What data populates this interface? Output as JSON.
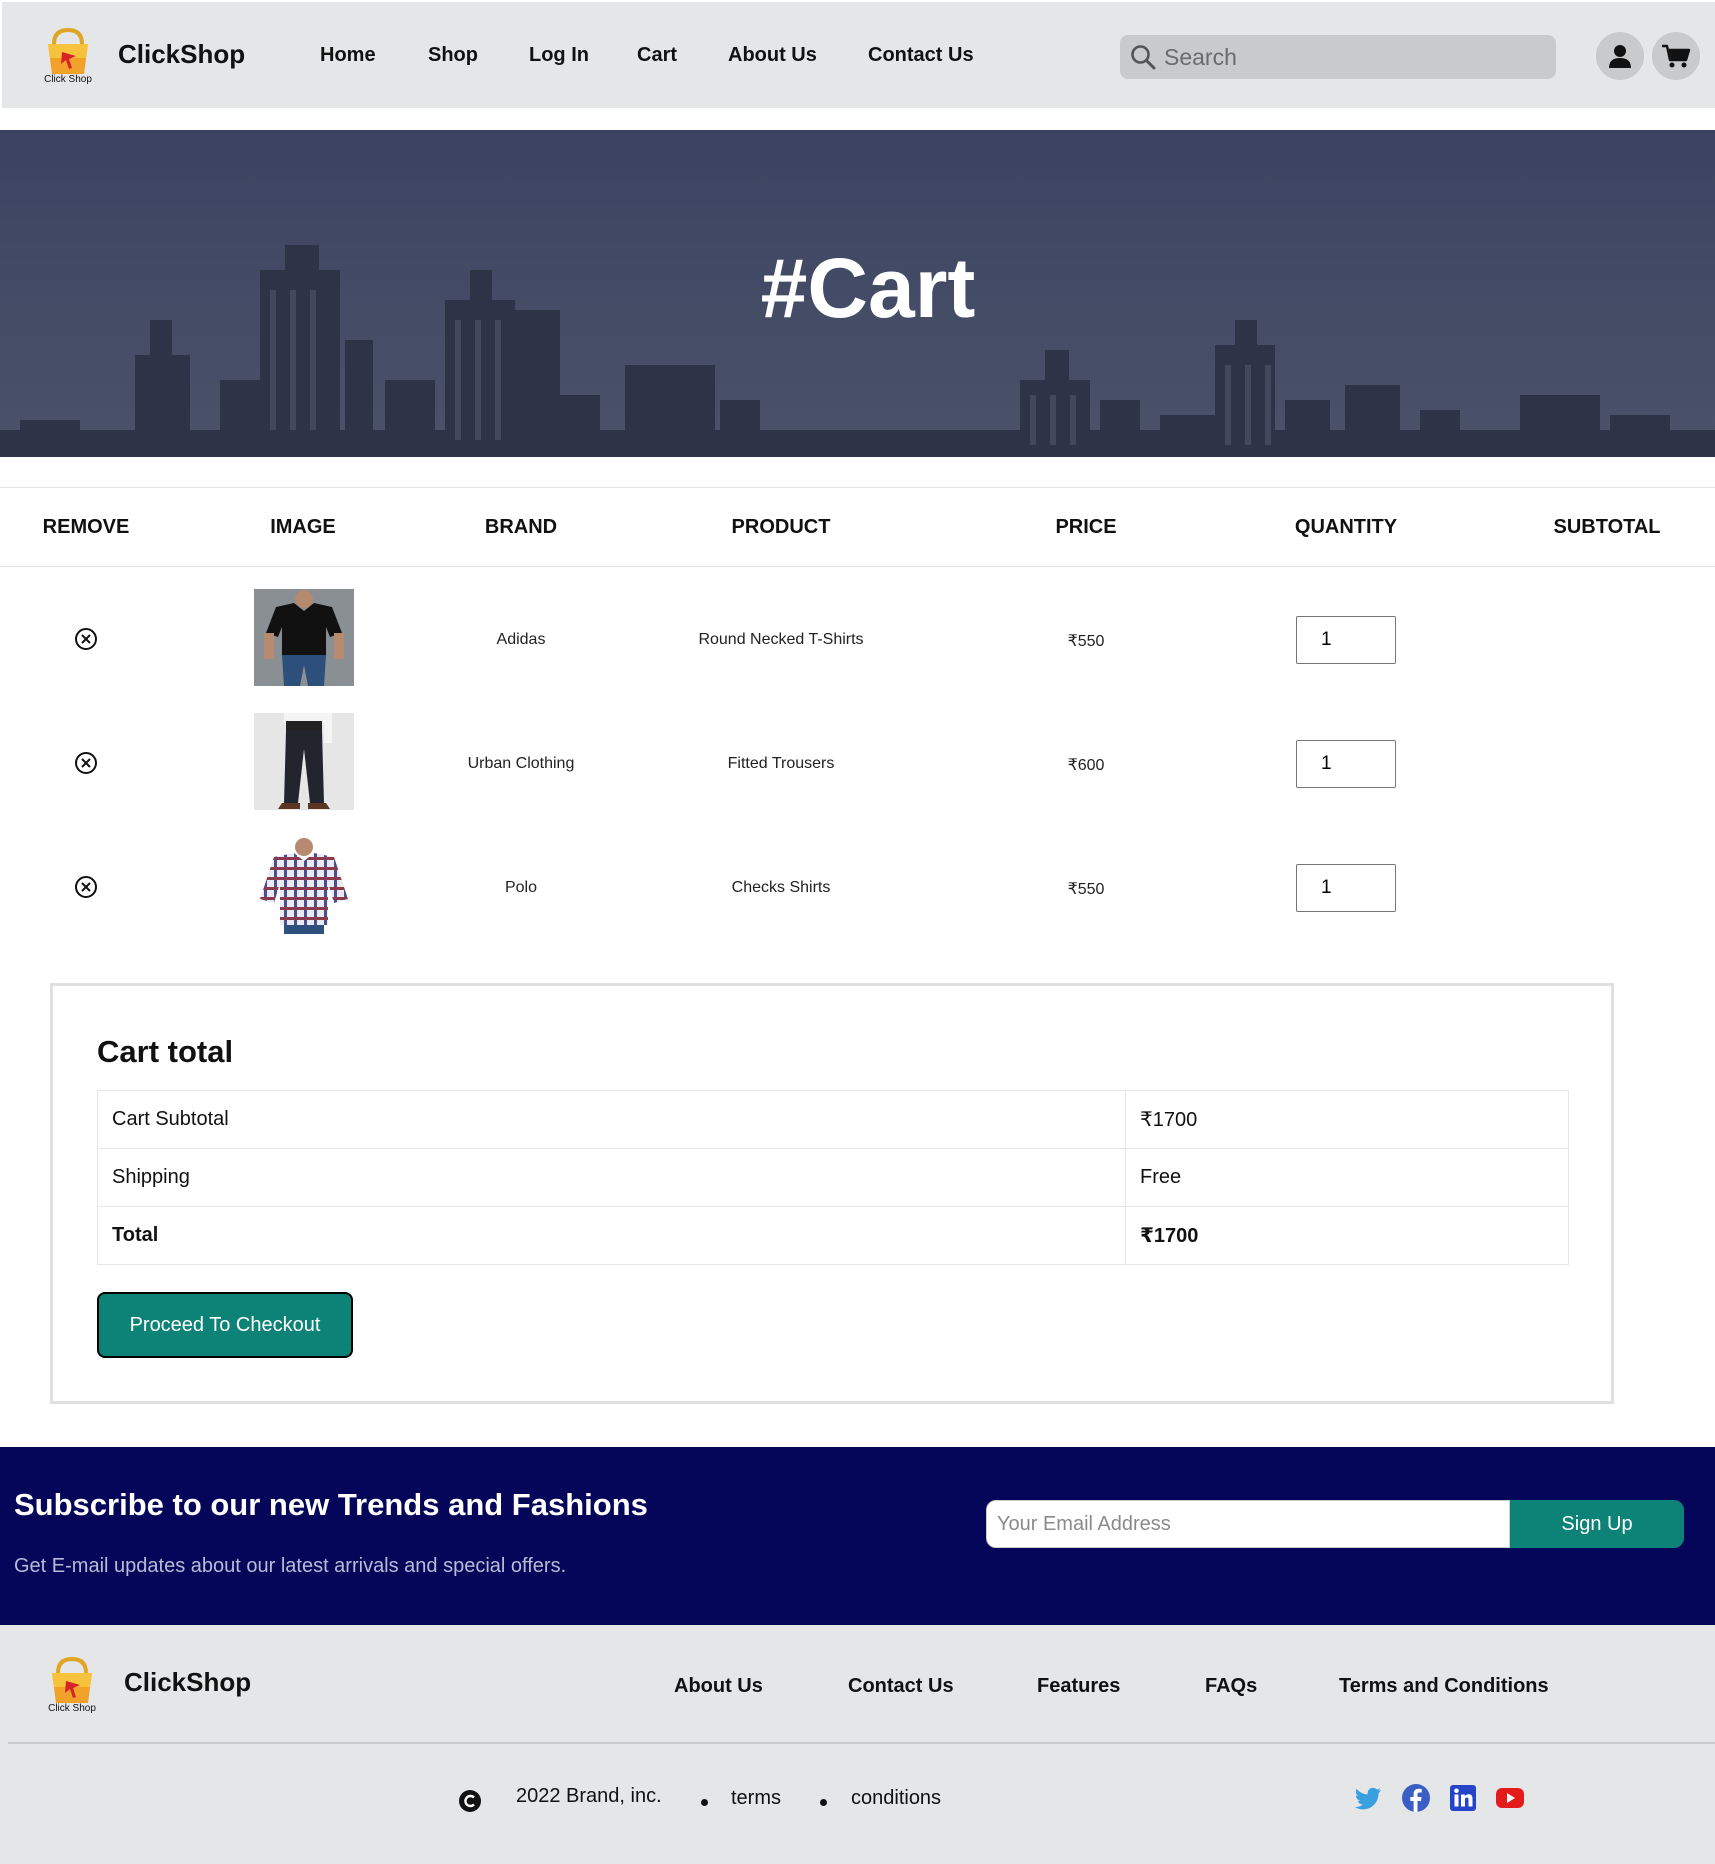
{
  "header": {
    "brand": "ClickShop",
    "logo_text": "Click Shop",
    "nav": [
      "Home",
      "Shop",
      "Log In",
      "Cart",
      "About Us",
      "Contact Us"
    ],
    "search_placeholder": "Search"
  },
  "hero": {
    "title": "#Cart"
  },
  "cart": {
    "columns": [
      "REMOVE",
      "IMAGE",
      "BRAND",
      "PRODUCT",
      "PRICE",
      "QUANTITY",
      "SUBTOTAL"
    ],
    "items": [
      {
        "brand": "Adidas",
        "product": "Round Necked T-Shirts",
        "price": "₹550",
        "quantity": "1",
        "image": "black t-shirt"
      },
      {
        "brand": "Urban Clothing",
        "product": "Fitted Trousers",
        "price": "₹600",
        "quantity": "1",
        "image": "dark trousers"
      },
      {
        "brand": "Polo",
        "product": "Checks Shirts",
        "price": "₹550",
        "quantity": "1",
        "image": "checked shirt"
      }
    ]
  },
  "cart_total": {
    "title": "Cart total",
    "rows": [
      {
        "label": "Cart Subtotal",
        "value": "₹1700"
      },
      {
        "label": "Shipping",
        "value": "Free"
      },
      {
        "label": "Total",
        "value": "₹1700"
      }
    ],
    "checkout_label": "Proceed To Checkout",
    "checkout_color": "#0d8276"
  },
  "newsletter": {
    "title": "Subscribe to our new Trends and Fashions",
    "subtitle": "Get E-mail updates about our latest arrivals and special offers.",
    "email_placeholder": "Your Email Address",
    "signup_label": "Sign Up",
    "background": "#05065a"
  },
  "footer": {
    "brand": "ClickShop",
    "logo_text": "Click Shop",
    "links": [
      "About Us",
      "Contact Us",
      "Features",
      "FAQs",
      "Terms and Conditions"
    ],
    "copyright": "2022 Brand, inc.",
    "legal": [
      "terms",
      "conditions"
    ],
    "social": [
      "twitter-icon",
      "facebook-icon",
      "linkedin-icon",
      "youtube-icon"
    ]
  }
}
